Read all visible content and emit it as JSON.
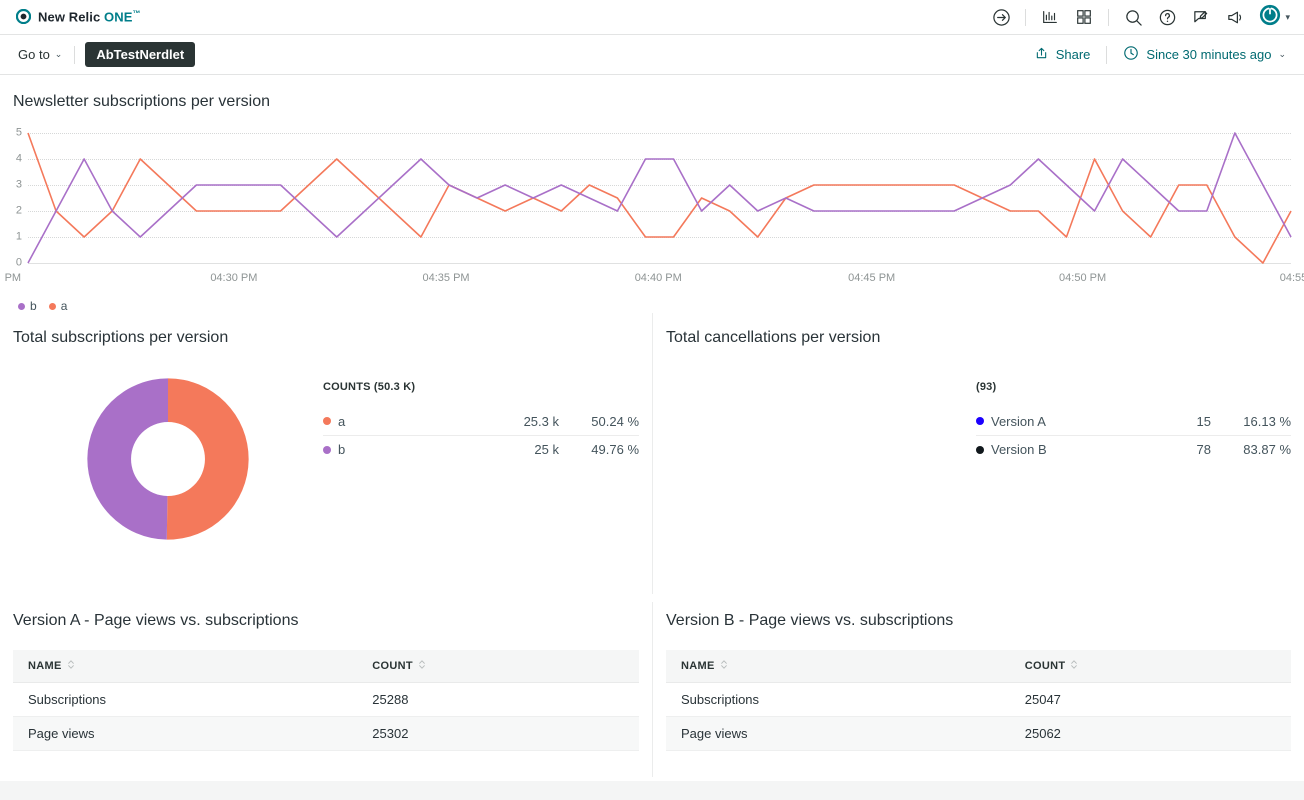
{
  "topbar": {
    "brand_primary": "New Relic ",
    "brand_accent": "ONE",
    "brand_tm": "™",
    "icons": [
      {
        "name": "launcher-icon",
        "label": "launcher"
      },
      {
        "name": "chart-bars-icon",
        "label": "data explorer"
      },
      {
        "name": "apps-grid-icon",
        "label": "apps"
      },
      {
        "name": "search-icon",
        "label": "search"
      },
      {
        "name": "help-icon",
        "label": "help"
      },
      {
        "name": "feedback-icon",
        "label": "feedback"
      },
      {
        "name": "announcements-icon",
        "label": "whats new"
      }
    ]
  },
  "subnav": {
    "goto_label": "Go to",
    "crumb_label": "AbTestNerdlet",
    "share_label": "Share",
    "time_label": "Since 30 minutes ago"
  },
  "colors": {
    "series_a": "#f4795b",
    "series_b": "#a970c8",
    "version_a": "#1c00ff",
    "version_b": "#11181c",
    "accent_teal": "#016a71",
    "crumb_bg": "#2a3434"
  },
  "line_panel": {
    "title": "Newsletter subscriptions per version",
    "legend": [
      {
        "label": "b",
        "color": "#a970c8"
      },
      {
        "label": "a",
        "color": "#f4795b"
      }
    ]
  },
  "subscriptions_panel": {
    "title": "Total subscriptions per version",
    "facet_header": "COUNTS (50.3 K)",
    "rows": [
      {
        "label": "a",
        "color": "#f4795b",
        "value": "25.3 k",
        "percent": "50.24 %"
      },
      {
        "label": "b",
        "color": "#a970c8",
        "value": "25 k",
        "percent": "49.76 %"
      }
    ]
  },
  "cancellations_panel": {
    "title": "Total cancellations per version",
    "facet_header": "(93)",
    "rows": [
      {
        "label": "Version A",
        "color": "#1c00ff",
        "value": "15",
        "percent": "16.13 %"
      },
      {
        "label": "Version B",
        "color": "#11181c",
        "value": "78",
        "percent": "83.87 %"
      }
    ]
  },
  "table_a": {
    "title": "Version A - Page views vs. subscriptions",
    "columns": [
      "NAME",
      "COUNT"
    ],
    "rows": [
      {
        "name": "Subscriptions",
        "count": "25288"
      },
      {
        "name": "Page views",
        "count": "25302"
      }
    ]
  },
  "table_b": {
    "title": "Version B - Page views vs. subscriptions",
    "columns": [
      "NAME",
      "COUNT"
    ],
    "rows": [
      {
        "name": "Subscriptions",
        "count": "25047"
      },
      {
        "name": "Page views",
        "count": "25062"
      }
    ]
  },
  "chart_data": {
    "type": "line",
    "title": "Newsletter subscriptions per version",
    "xlabel": "",
    "ylabel": "",
    "ylim": [
      0,
      5
    ],
    "yticks": [
      0,
      1,
      2,
      3,
      4,
      5
    ],
    "grid": true,
    "legend_position": "bottom-left",
    "x_tick_labels": [
      "PM",
      "04:30 PM",
      "04:35 PM",
      "04:40 PM",
      "04:45 PM",
      "04:50 PM",
      "04:55"
    ],
    "x_tick_positions_pct": [
      -1.2,
      16.3,
      33.1,
      49.9,
      66.8,
      83.5,
      100.2
    ],
    "series": [
      {
        "name": "a",
        "color": "#f4795b",
        "values": [
          5,
          2,
          1,
          2,
          4,
          3,
          2,
          2,
          2,
          2,
          3,
          4,
          3,
          2,
          1,
          3,
          2.5,
          2,
          2.5,
          2,
          3,
          2.5,
          1,
          1,
          2.5,
          2,
          1,
          2.5,
          3,
          3,
          3,
          3,
          3,
          3,
          2.5,
          2,
          2,
          1,
          4,
          2,
          1,
          3,
          3,
          1,
          0,
          2
        ]
      },
      {
        "name": "b",
        "color": "#a970c8",
        "values": [
          0,
          2,
          4,
          2,
          1,
          2,
          3,
          3,
          3,
          3,
          2,
          1,
          2,
          3,
          4,
          3,
          2.5,
          3,
          2.5,
          3,
          2.5,
          2,
          4,
          4,
          2,
          3,
          2,
          2.5,
          2,
          2,
          2,
          2,
          2,
          2,
          2.5,
          3,
          4,
          3,
          2,
          4,
          3,
          2,
          2,
          5,
          3,
          1
        ]
      }
    ]
  },
  "donut": {
    "type": "pie",
    "slices": [
      {
        "label": "a",
        "color": "#f4795b",
        "percent": 50.24
      },
      {
        "label": "b",
        "color": "#a970c8",
        "percent": 49.76
      }
    ]
  }
}
